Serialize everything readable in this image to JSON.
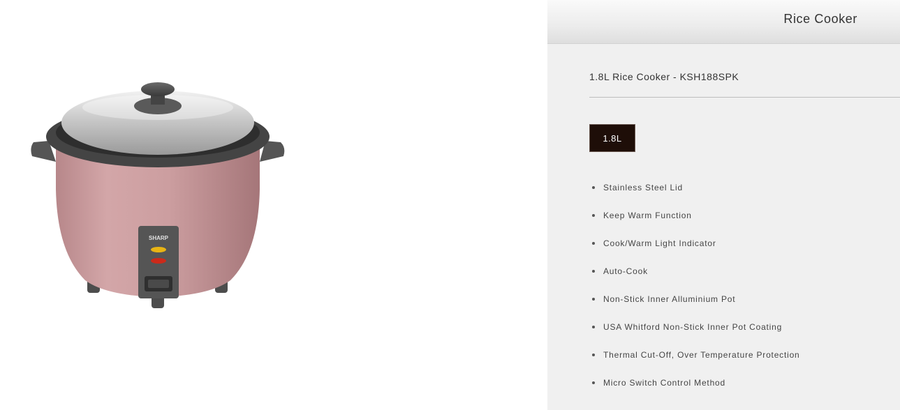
{
  "panel": {
    "title": "Rice Cooker",
    "product_name": "1.8L Rice Cooker - KSH188SPK",
    "size_option": "1.8L",
    "features": [
      "Stainless Steel Lid",
      "Keep Warm Function",
      "Cook/Warm Light Indicator",
      "Auto-Cook",
      "Non-Stick Inner Alluminium Pot",
      "USA Whitford Non-Stick Inner Pot Coating",
      "Thermal Cut-Off, Over Temperature Protection",
      "Micro Switch Control Method"
    ]
  },
  "product_image": {
    "brand_label": "SHARP",
    "body_color": "#c99a9c",
    "trim_color": "#4a4a4a",
    "lid_color": "#cfcfcf"
  },
  "colors": {
    "panel_bg": "#f0f0f0",
    "button_bg": "#1e0e08",
    "button_text": "#ffffff"
  }
}
